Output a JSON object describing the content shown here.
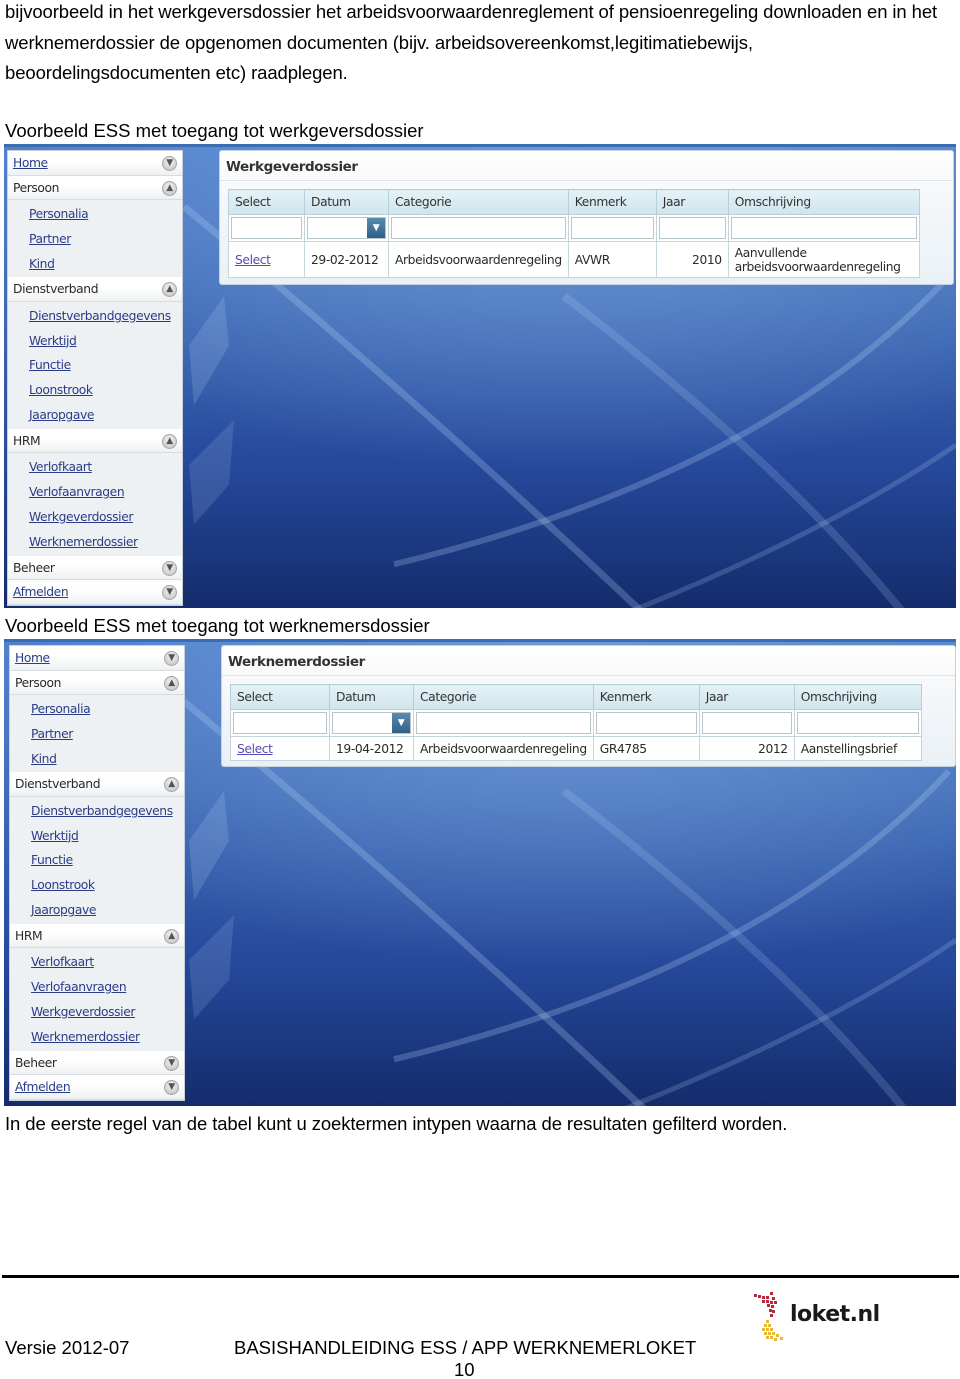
{
  "intro": "bijvoorbeeld in het werkgeversdossier het arbeidsvoorwaardenreglement of pensioenregeling downloaden en in het werknemerdossier de opgenomen documenten (bijv. arbeidsovereenkomst,legitimatiebewijs, beoordelingsdocumenten etc) raadplegen.",
  "captions": {
    "employer": "Voorbeeld ESS met toegang tot werkgeversdossier",
    "employee": "Voorbeeld ESS met toegang tot werknemersdossier"
  },
  "sidebar": {
    "home": "Home",
    "persoon": "Persoon",
    "persoon_items": [
      "Personalia",
      "Partner",
      "Kind"
    ],
    "dienstverband": "Dienstverband",
    "dienstverband_items": [
      "Dienstverbandgegevens",
      "Werktijd",
      "Functie",
      "Loonstrook",
      "Jaaropgave"
    ],
    "hrm": "HRM",
    "hrm_items": [
      "Verlofkaart",
      "Verlofaanvragen",
      "Werkgeverdossier",
      "Werknemerdossier"
    ],
    "beheer": "Beheer",
    "afmelden": "Afmelden",
    "icons": {
      "expanded": "circle-arrow-up-icon",
      "collapsed": "circle-arrow-down-icon"
    }
  },
  "columns": [
    "Select",
    "Datum",
    "Categorie",
    "Kenmerk",
    "Jaar",
    "Omschrijving"
  ],
  "employer_panel": {
    "title": "Werkgeverdossier",
    "rows": [
      {
        "select": "Select",
        "datum": "29-02-2012",
        "categorie": "Arbeidsvoorwaardenregeling",
        "kenmerk": "AVWR",
        "jaar": "2010",
        "omschrijving_1": "Aanvullende",
        "omschrijving_2": "arbeidsvoorwaardenregeling"
      }
    ]
  },
  "employee_panel": {
    "title": "Werknemerdossier",
    "rows": [
      {
        "select": "Select",
        "datum": "19-04-2012",
        "categorie": "Arbeidsvoorwaardenregeling",
        "kenmerk": "GR4785",
        "jaar": "2012",
        "omschrijving": "Aanstellingsbrief"
      }
    ]
  },
  "outro": "In de eerste regel van de tabel kunt u zoektermen intypen waarna de resultaten gefilterd worden.",
  "footer": {
    "version": "Versie 2012-07",
    "title": "BASISHANDLEIDING ESS / APP WERKNEMERLOKET",
    "page": "10",
    "logo_text": "loket.nl"
  },
  "colors": {
    "link": "#2b3c88",
    "select_link": "#5a48b8",
    "logo_red": "#b8283a",
    "logo_yellow": "#e8b83a"
  }
}
